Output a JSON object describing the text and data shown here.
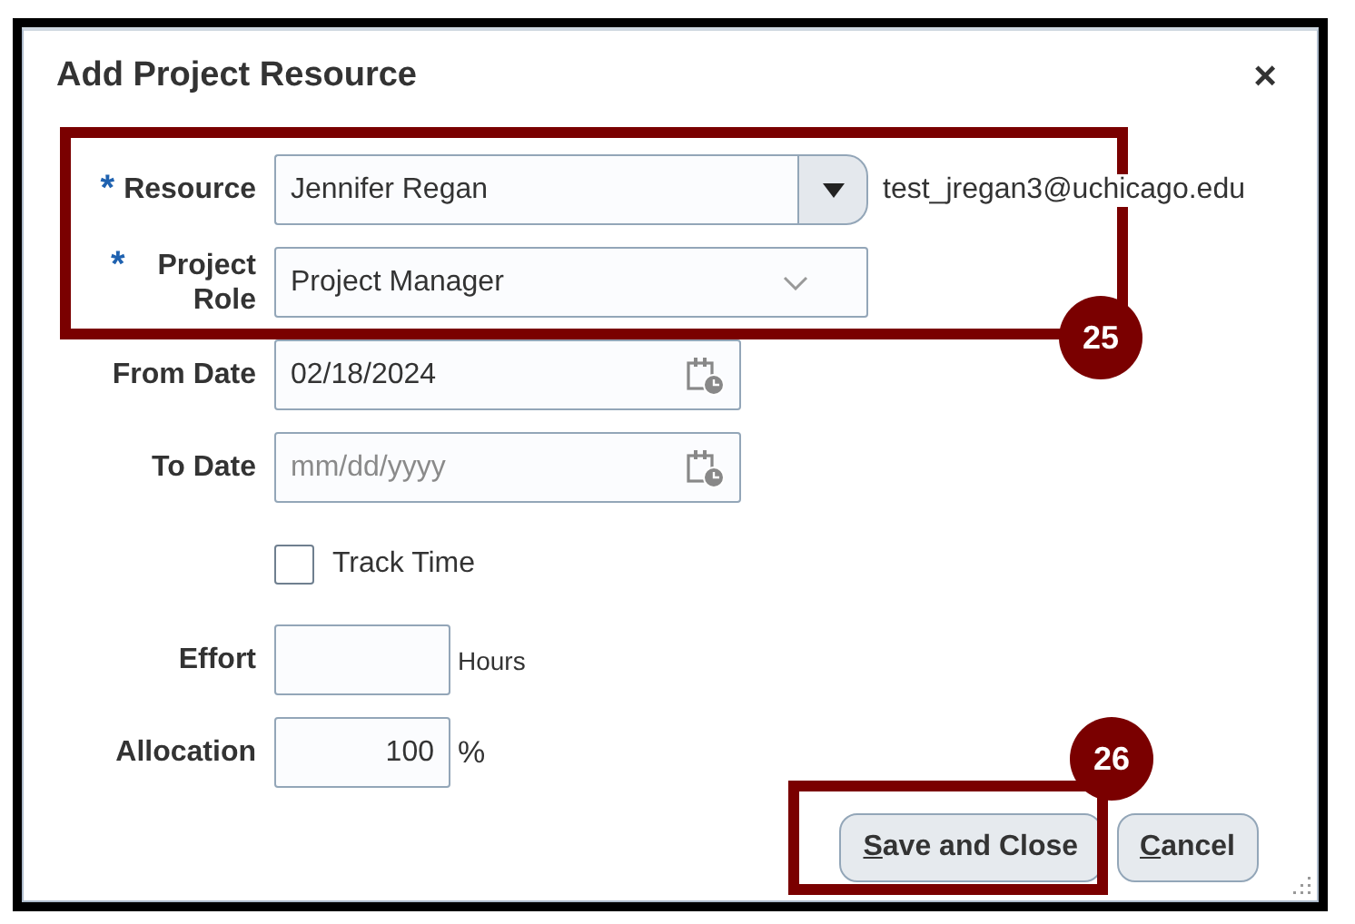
{
  "dialog": {
    "title": "Add Project Resource",
    "close": "×"
  },
  "fields": [
    {
      "kind": "select",
      "label": "Resource",
      "required_mark": "*",
      "value": "Jennifer Regan",
      "note": "test_jregan3@uchicago.edu"
    },
    {
      "kind": "choice",
      "label": "Project Role",
      "required_mark": "*",
      "value": "Project Manager"
    },
    {
      "kind": "date",
      "label": "From Date",
      "value": "02/18/2024"
    },
    {
      "kind": "date",
      "label": "To Date",
      "placeholder": "mm/dd/yyyy"
    },
    {
      "kind": "checkbox",
      "label": "Track Time",
      "checked": false
    },
    {
      "kind": "number",
      "label": "Effort",
      "unit": "Hours"
    },
    {
      "kind": "number",
      "label": "Allocation",
      "value": "100",
      "unit": "%"
    }
  ],
  "buttons": [
    {
      "mnemonic": "S",
      "rest": "ave and Close"
    },
    {
      "mnemonic": "C",
      "rest": "ancel"
    }
  ],
  "annotations": [
    {
      "number": "25"
    },
    {
      "number": "26"
    }
  ]
}
